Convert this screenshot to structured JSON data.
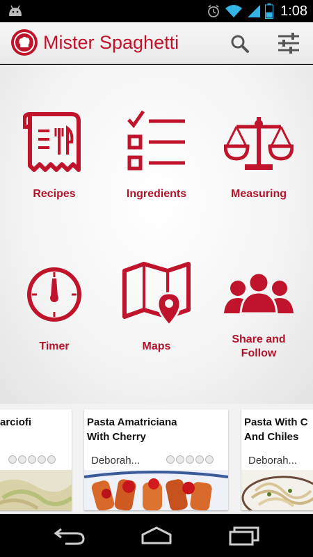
{
  "status_bar": {
    "time": "1:08",
    "battery_level": 0.45
  },
  "app": {
    "title": "Mister Spaghetti",
    "accent": "#c0142c"
  },
  "toolbar": {
    "search_icon": "search-icon",
    "settings_icon": "sliders-icon"
  },
  "menu": {
    "items": [
      {
        "label": "Recipes",
        "icon": "recipe-receipt-icon"
      },
      {
        "label": "Ingredients",
        "icon": "checklist-icon"
      },
      {
        "label": "Measuring",
        "icon": "scale-icon"
      },
      {
        "label": "Timer",
        "icon": "timer-icon"
      },
      {
        "label": "Maps",
        "icon": "map-pin-icon"
      },
      {
        "label": "Share and\nFollow",
        "icon": "people-group-icon"
      }
    ]
  },
  "recipes": [
    {
      "title": "arciofi",
      "author": ""
    },
    {
      "title": "Pasta Amatriciana\nWith Cherry",
      "author": "Deborah..."
    },
    {
      "title": "Pasta With C\nAnd Chiles",
      "author": "Deborah..."
    }
  ]
}
